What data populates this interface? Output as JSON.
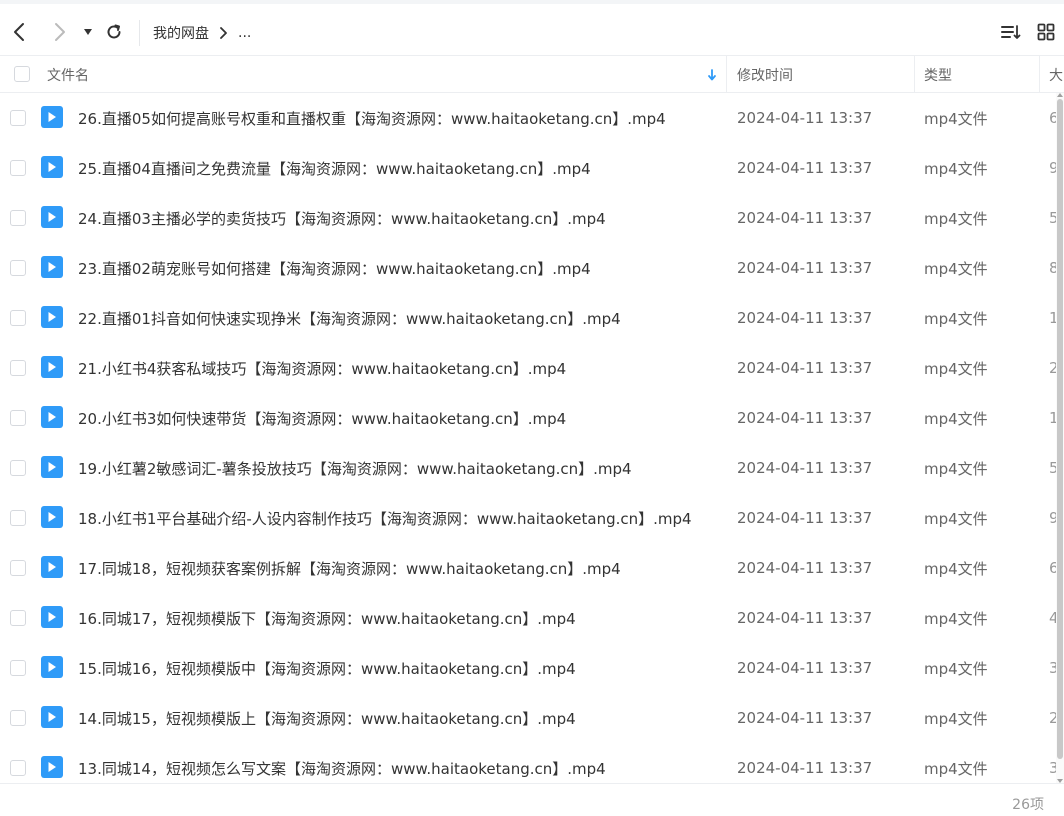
{
  "toolbar": {
    "breadcrumb_root": "我的网盘",
    "breadcrumb_sep": ">",
    "breadcrumb_more": "..."
  },
  "table": {
    "col_name": "文件名",
    "col_time": "修改时间",
    "col_type": "类型",
    "col_size": "大"
  },
  "rows": [
    {
      "name": "26.直播05如何提高账号权重和直播权重【海淘资源网：www.haitaoketang.cn】.mp4",
      "time": "2024-04-11 13:37",
      "type": "mp4文件",
      "size": "6"
    },
    {
      "name": "25.直播04直播间之免费流量【海淘资源网：www.haitaoketang.cn】.mp4",
      "time": "2024-04-11 13:37",
      "type": "mp4文件",
      "size": "9"
    },
    {
      "name": "24.直播03主播必学的卖货技巧【海淘资源网：www.haitaoketang.cn】.mp4",
      "time": "2024-04-11 13:37",
      "type": "mp4文件",
      "size": "5"
    },
    {
      "name": "23.直播02萌宠账号如何搭建【海淘资源网：www.haitaoketang.cn】.mp4",
      "time": "2024-04-11 13:37",
      "type": "mp4文件",
      "size": "8"
    },
    {
      "name": "22.直播01抖音如何快速实现挣米【海淘资源网：www.haitaoketang.cn】.mp4",
      "time": "2024-04-11 13:37",
      "type": "mp4文件",
      "size": "1"
    },
    {
      "name": "21.小红书4获客私域技巧【海淘资源网：www.haitaoketang.cn】.mp4",
      "time": "2024-04-11 13:37",
      "type": "mp4文件",
      "size": "2"
    },
    {
      "name": "20.小红书3如何快速带货【海淘资源网：www.haitaoketang.cn】.mp4",
      "time": "2024-04-11 13:37",
      "type": "mp4文件",
      "size": "1"
    },
    {
      "name": "19.小红薯2敏感词汇-薯条投放技巧【海淘资源网：www.haitaoketang.cn】.mp4",
      "time": "2024-04-11 13:37",
      "type": "mp4文件",
      "size": "5"
    },
    {
      "name": "18.小红书1平台基础介绍-人设内容制作技巧【海淘资源网：www.haitaoketang.cn】.mp4",
      "time": "2024-04-11 13:37",
      "type": "mp4文件",
      "size": "9"
    },
    {
      "name": "17.同城18，短视频获客案例拆解【海淘资源网：www.haitaoketang.cn】.mp4",
      "time": "2024-04-11 13:37",
      "type": "mp4文件",
      "size": "6"
    },
    {
      "name": "16.同城17，短视频模版下【海淘资源网：www.haitaoketang.cn】.mp4",
      "time": "2024-04-11 13:37",
      "type": "mp4文件",
      "size": "4"
    },
    {
      "name": "15.同城16，短视频模版中【海淘资源网：www.haitaoketang.cn】.mp4",
      "time": "2024-04-11 13:37",
      "type": "mp4文件",
      "size": "3"
    },
    {
      "name": "14.同城15，短视频模版上【海淘资源网：www.haitaoketang.cn】.mp4",
      "time": "2024-04-11 13:37",
      "type": "mp4文件",
      "size": "2"
    },
    {
      "name": "13.同城14，短视频怎么写文案【海淘资源网：www.haitaoketang.cn】.mp4",
      "time": "2024-04-11 13:37",
      "type": "mp4文件",
      "size": "3"
    }
  ],
  "footer": {
    "count": "26项"
  },
  "icons": {
    "back": "chevron-left-icon",
    "forward": "chevron-right-icon",
    "history": "caret-down-icon",
    "refresh": "refresh-icon",
    "sort": "sort-list-icon",
    "grid": "grid-view-icon",
    "sort_indicator": "arrow-down-icon",
    "file": "video-file-icon"
  },
  "colors": {
    "accent": "#2f9bf8",
    "text": "#333333",
    "muted": "#666666"
  }
}
